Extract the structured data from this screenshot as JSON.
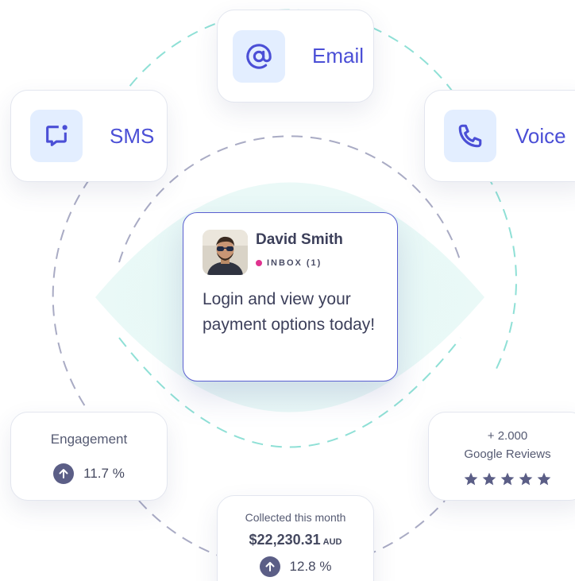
{
  "channels": {
    "email": {
      "label": "Email",
      "icon": "at-sign-icon"
    },
    "sms": {
      "label": "SMS",
      "icon": "message-notification-icon"
    },
    "voice": {
      "label": "Voice",
      "icon": "phone-icon"
    }
  },
  "message": {
    "sender": "David Smith",
    "folder": "INBOX (1)",
    "body": "Login and view your payment options today!",
    "status_dot_color": "#e0338f"
  },
  "stats": {
    "engagement": {
      "title": "Engagement",
      "value": "11.7 %",
      "trend": "up"
    },
    "reviews": {
      "count": "+ 2.000",
      "label": "Google Reviews",
      "rating": 5
    },
    "collected": {
      "title": "Collected this month",
      "amount": "$22,230.31",
      "currency": "AUD",
      "change": "12.8 %",
      "trend": "up"
    }
  },
  "colors": {
    "accent": "#4b4fd6",
    "icon_bg": "#e3eeff",
    "teal_ring": "#8fe0d6",
    "gray_ring": "#a9abc4",
    "stat_icon": "#5b5e86"
  }
}
